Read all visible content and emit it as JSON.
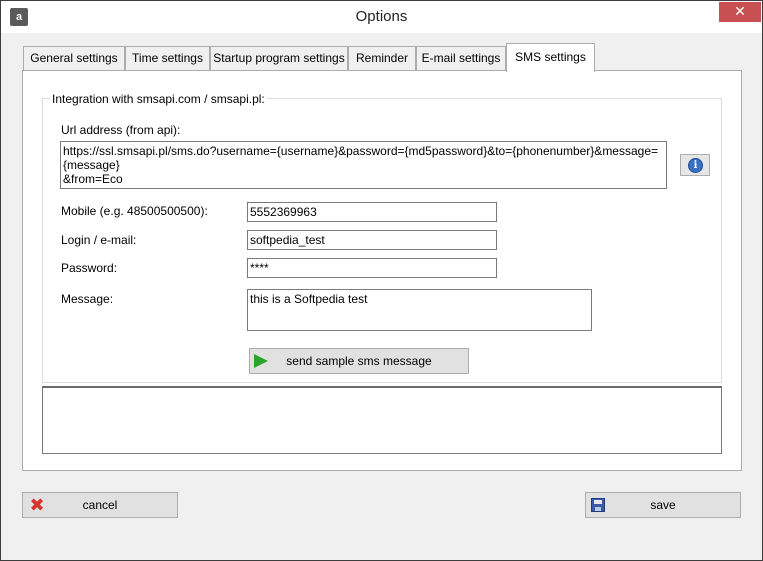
{
  "window": {
    "title": "Options",
    "icon": "app-icon",
    "icon_text": "a",
    "close_glyph": "✕"
  },
  "tabs": [
    {
      "label": "General settings"
    },
    {
      "label": "Time settings"
    },
    {
      "label": "Startup program settings"
    },
    {
      "label": "Reminder"
    },
    {
      "label": "E-mail settings"
    },
    {
      "label": "SMS settings",
      "active": true
    }
  ],
  "sms": {
    "group_title": "Integration with smsapi.com / smsapi.pl:",
    "url_label": "Url address (from api):",
    "url_value": "https://ssl.smsapi.pl/sms.do?username={username}&password={md5password}&to={phonenumber}&message={message}\n&from=Eco",
    "info_glyph": "i",
    "mobile_label": "Mobile (e.g. 48500500500):",
    "mobile_value": "5552369963",
    "login_label": "Login / e-mail:",
    "login_value": "softpedia_test",
    "password_label": "Password:",
    "password_value": "****",
    "message_label": "Message:",
    "message_value": "this is a Softpedia test",
    "send_button": "send sample sms message",
    "log_value": ""
  },
  "footer": {
    "cancel_button": "cancel",
    "save_button": "save"
  },
  "colors": {
    "close_button": "#c75050",
    "send_icon": "#2aa52a",
    "cancel_icon": "#d8342c",
    "save_icon": "#3b5ba8",
    "info_icon": "#3a6fc4"
  }
}
